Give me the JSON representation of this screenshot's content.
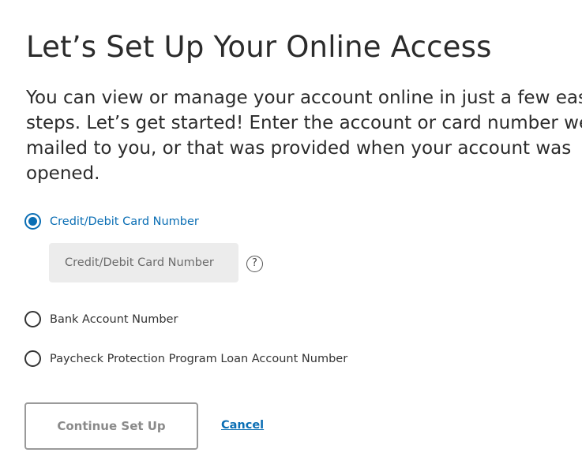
{
  "page": {
    "title": "Let’s Set Up Your Online Access",
    "intro_lines": [
      "You can view or manage your account online in just a few easy",
      "steps. Let’s get started! Enter the account or card number we",
      "mailed to you, or that was provided when your account was",
      "opened."
    ]
  },
  "options": {
    "card": {
      "label": "Credit/Debit Card Number",
      "selected": true
    },
    "bank": {
      "label": "Bank Account Number",
      "selected": false
    },
    "ppp": {
      "label": "Paycheck Protection Program Loan Account Number",
      "selected": false
    }
  },
  "card_input": {
    "placeholder": "Credit/Debit Card Number",
    "value": ""
  },
  "help": {
    "glyph": "?"
  },
  "actions": {
    "continue_label": "Continue Set Up",
    "cancel_label": "Cancel"
  },
  "colors": {
    "accent": "#0a6eb4",
    "text": "#2b2b2b",
    "input_bg": "#ececec",
    "disabled_text": "#8a8a8a"
  }
}
